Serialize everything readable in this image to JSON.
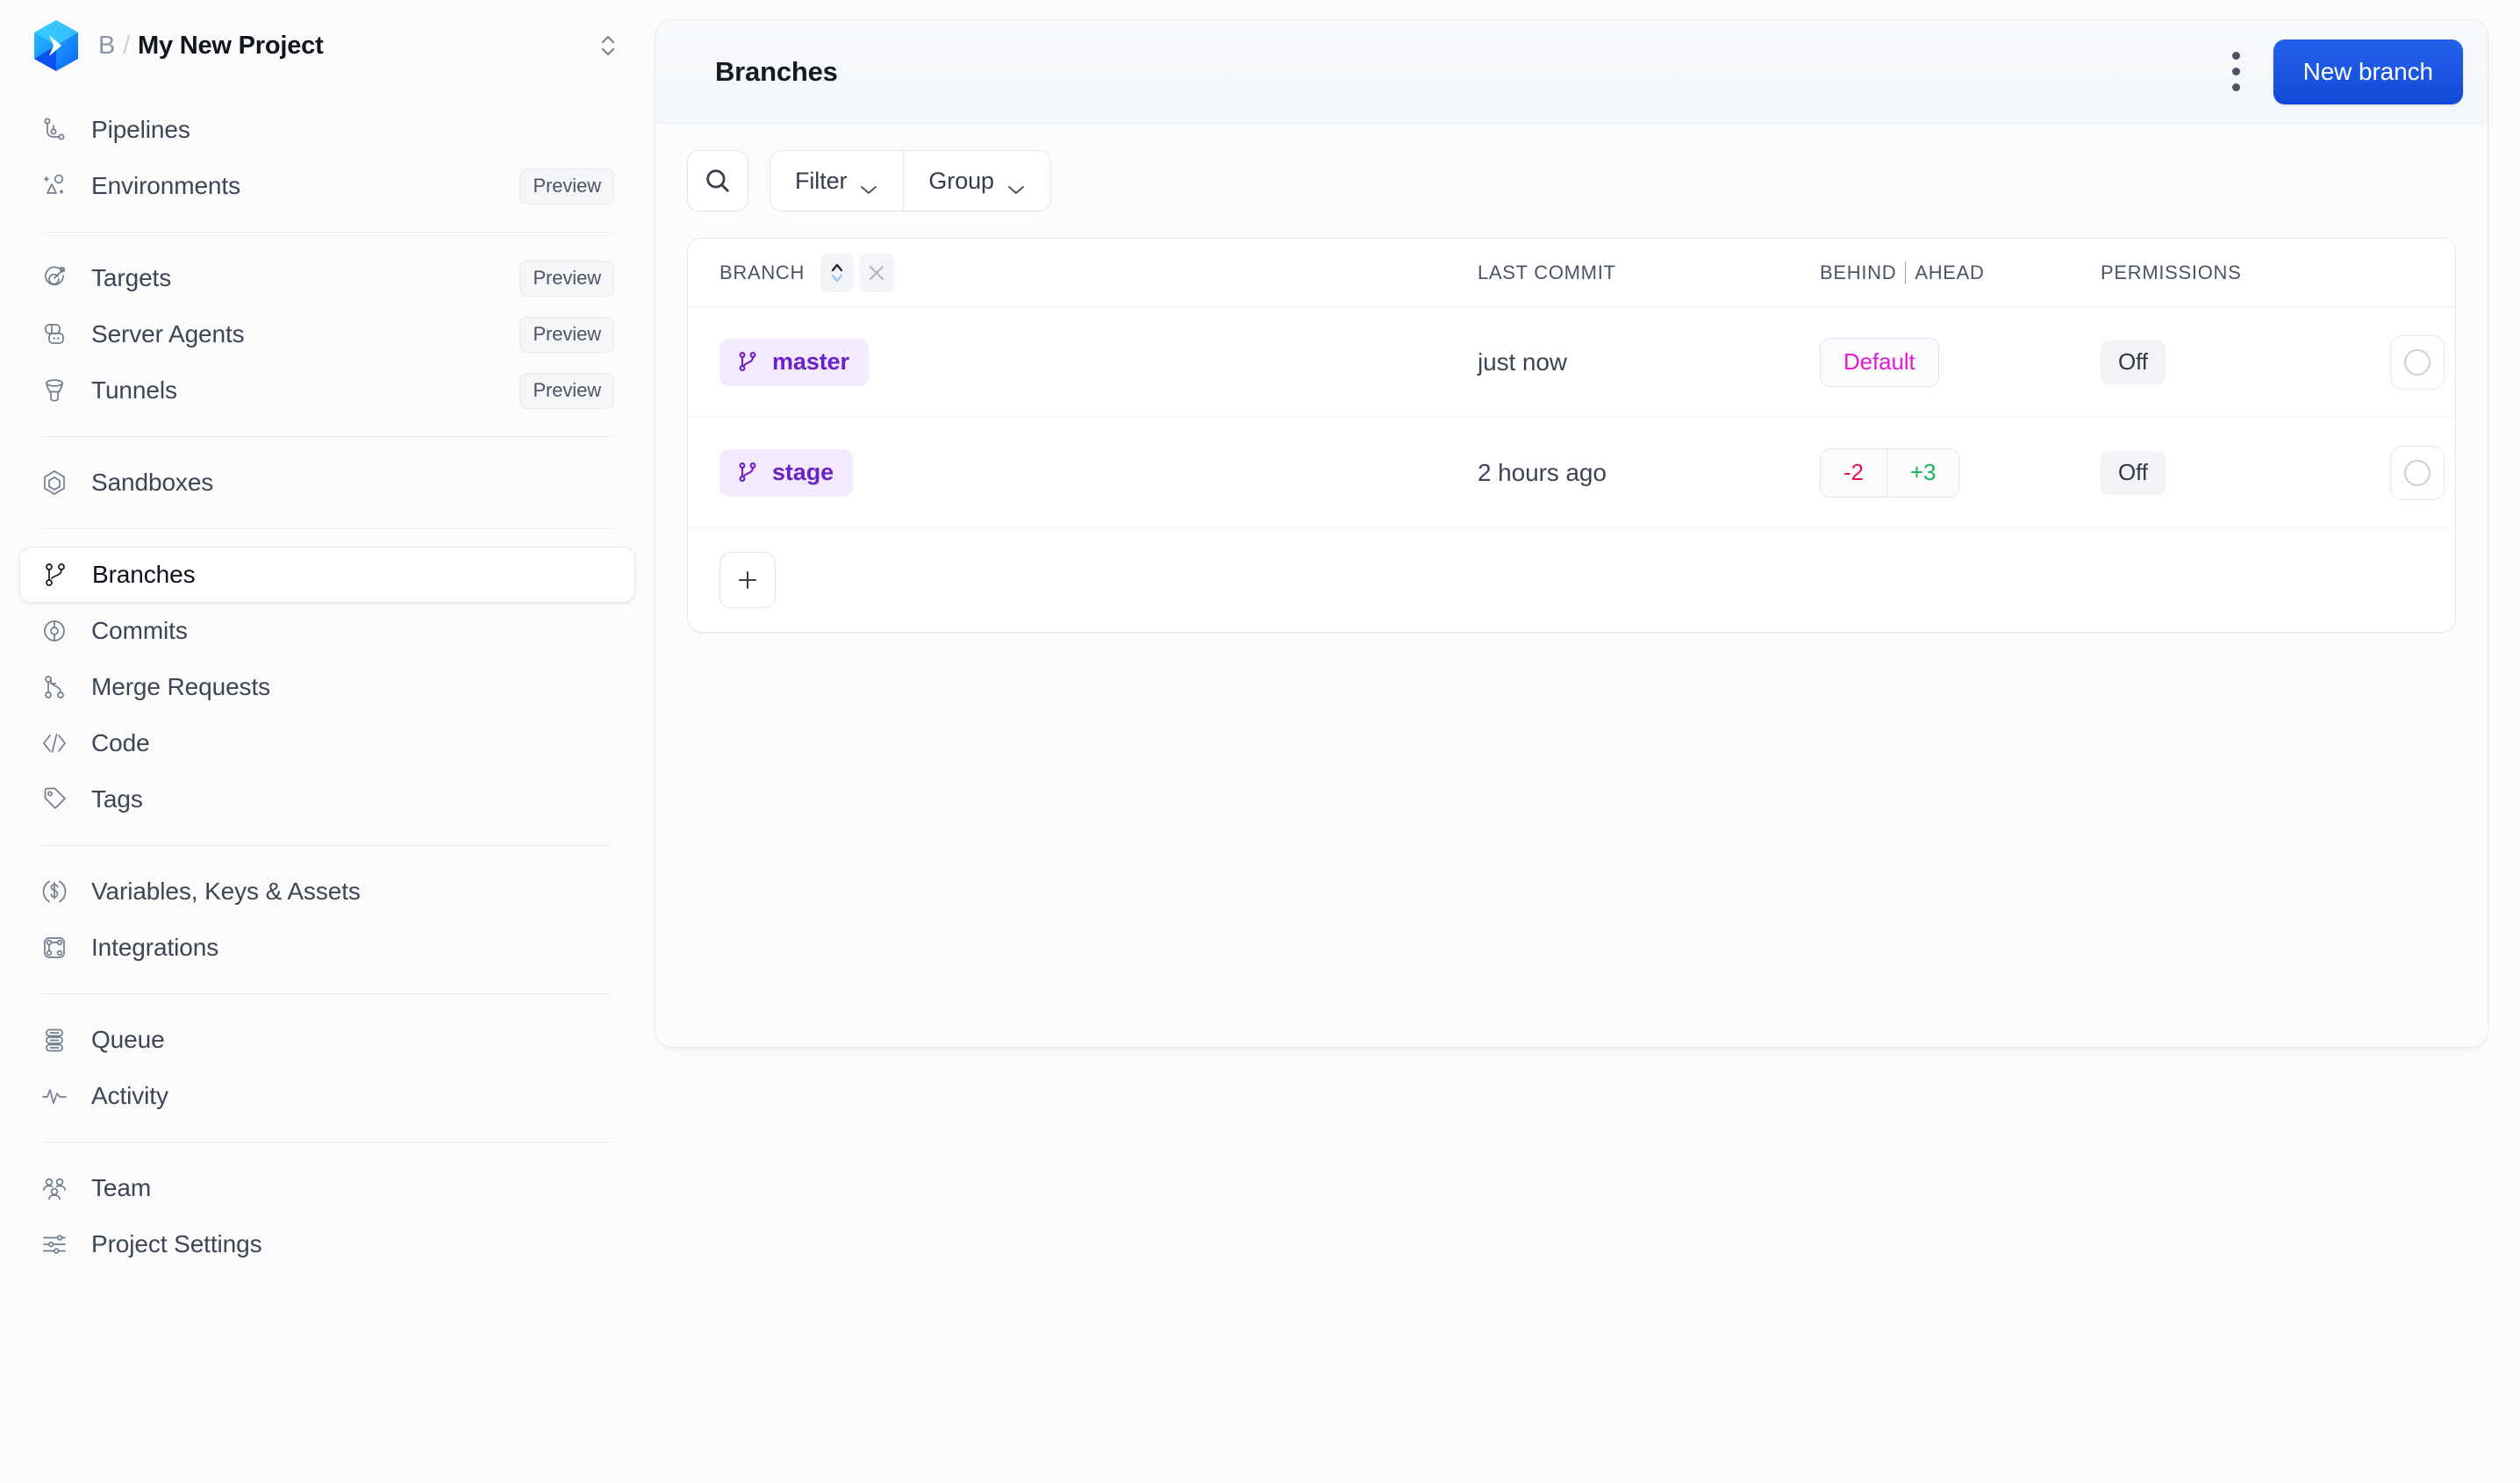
{
  "brand": {
    "org": "B",
    "separator": "/",
    "project": "My New Project",
    "logo_icon": "blue-hexagon-chevron-logo",
    "switcher_icon": "chevron-up-down-icon"
  },
  "sidebar": {
    "groups": [
      {
        "items": [
          {
            "label": "Pipelines",
            "icon": "pipeline-icon",
            "badge": null,
            "active": false
          },
          {
            "label": "Environments",
            "icon": "environments-icon",
            "badge": "Preview",
            "active": false
          }
        ]
      },
      {
        "items": [
          {
            "label": "Targets",
            "icon": "target-icon",
            "badge": "Preview",
            "active": false
          },
          {
            "label": "Server Agents",
            "icon": "server-agent-icon",
            "badge": "Preview",
            "active": false
          },
          {
            "label": "Tunnels",
            "icon": "tunnel-icon",
            "badge": "Preview",
            "active": false
          }
        ]
      },
      {
        "items": [
          {
            "label": "Sandboxes",
            "icon": "sandbox-hexagon-icon",
            "badge": null,
            "active": false
          }
        ]
      },
      {
        "items": [
          {
            "label": "Branches",
            "icon": "branch-icon",
            "badge": null,
            "active": true
          },
          {
            "label": "Commits",
            "icon": "commit-icon",
            "badge": null,
            "active": false
          },
          {
            "label": "Merge Requests",
            "icon": "merge-request-icon",
            "badge": null,
            "active": false
          },
          {
            "label": "Code",
            "icon": "code-brackets-icon",
            "badge": null,
            "active": false
          },
          {
            "label": "Tags",
            "icon": "tag-icon",
            "badge": null,
            "active": false
          }
        ]
      },
      {
        "items": [
          {
            "label": "Variables, Keys & Assets",
            "icon": "dollar-circle-icon",
            "badge": null,
            "active": false
          },
          {
            "label": "Integrations",
            "icon": "integrations-icon",
            "badge": null,
            "active": false
          }
        ]
      },
      {
        "items": [
          {
            "label": "Queue",
            "icon": "queue-icon",
            "badge": null,
            "active": false
          },
          {
            "label": "Activity",
            "icon": "activity-pulse-icon",
            "badge": null,
            "active": false
          }
        ]
      },
      {
        "items": [
          {
            "label": "Team",
            "icon": "team-people-icon",
            "badge": null,
            "active": false
          },
          {
            "label": "Project Settings",
            "icon": "sliders-settings-icon",
            "badge": null,
            "active": false
          }
        ]
      }
    ]
  },
  "panel": {
    "title": "Branches",
    "kebab_icon": "more-vertical-icon",
    "new_branch_label": "New branch",
    "accent_color": "#2563eb"
  },
  "toolbar": {
    "search_icon": "search-icon",
    "filter_label": "Filter",
    "group_label": "Group",
    "chevron_icon": "chevron-down-icon"
  },
  "table": {
    "columns": {
      "branch": "BRANCH",
      "last_commit": "LAST COMMIT",
      "behind": "BEHIND",
      "ahead": "AHEAD",
      "permissions": "PERMISSIONS"
    },
    "sort_icon": "sort-chevrons-icon",
    "clear_sort_icon": "close-x-icon",
    "add_row_icon": "plus-icon",
    "rows": [
      {
        "branch": "master",
        "branch_icon": "branch-icon",
        "last_commit": "just now",
        "ba_type": "default",
        "ba_default": "Default",
        "behind": null,
        "ahead": null,
        "permissions": "Off",
        "status_icon": "circle-outline-icon",
        "row_menu_icon": "more-vertical-icon"
      },
      {
        "branch": "stage",
        "branch_icon": "branch-icon",
        "last_commit": "2 hours ago",
        "ba_type": "counts",
        "ba_default": null,
        "behind": "-2",
        "ahead": "+3",
        "permissions": "Off",
        "status_icon": "circle-outline-icon",
        "row_menu_icon": "more-vertical-icon"
      }
    ]
  },
  "colors": {
    "chip_bg": "#f3eafe",
    "chip_text": "#6b21c8",
    "default_text": "#e21ad4",
    "behind_text": "#e0154f",
    "ahead_text": "#16b752"
  }
}
